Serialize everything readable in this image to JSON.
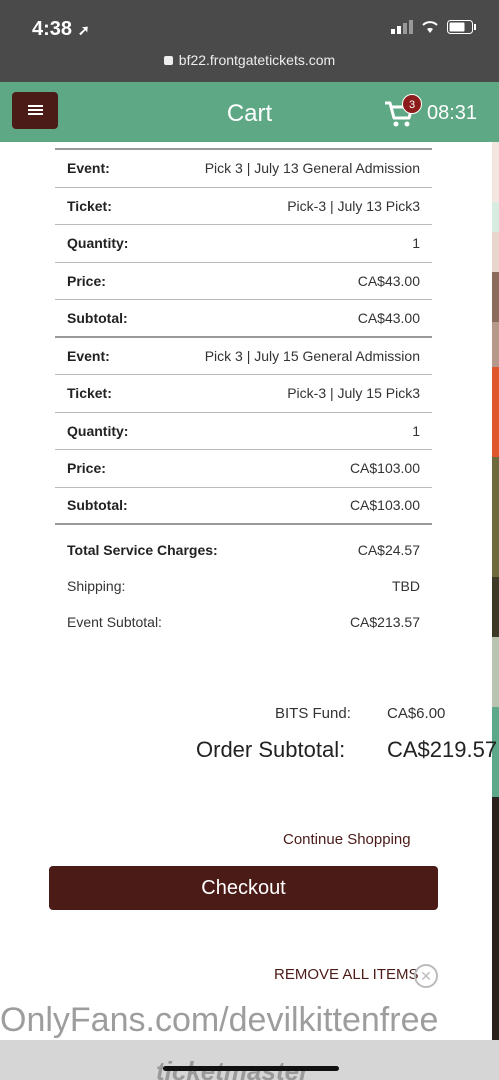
{
  "status_bar": {
    "time": "4:38",
    "url": "bf22.frontgatetickets.com"
  },
  "nav": {
    "title": "Cart",
    "cart_count": "3",
    "timer": "08:31"
  },
  "items": [
    {
      "event": "Pick 3 | July 13 General Admission",
      "ticket": "Pick-3 | July 13 Pick3",
      "quantity": "1",
      "price": "CA$43.00",
      "subtotal": "CA$43.00"
    },
    {
      "event": "Pick 3 | July 15 General Admission",
      "ticket": "Pick-3 | July 15 Pick3",
      "quantity": "1",
      "price": "CA$103.00",
      "subtotal": "CA$103.00"
    }
  ],
  "labels": {
    "event": "Event:",
    "ticket": "Ticket:",
    "quantity": "Quantity:",
    "price": "Price:",
    "subtotal": "Subtotal:"
  },
  "summary": {
    "service_label": "Total Service Charges:",
    "service_value": "CA$24.57",
    "shipping_label": "Shipping:",
    "shipping_value": "TBD",
    "event_subtotal_label": "Event Subtotal:",
    "event_subtotal_value": "CA$213.57"
  },
  "totals": {
    "bits_label": "BITS Fund:",
    "bits_value": "CA$6.00",
    "order_label": "Order Subtotal:",
    "order_value": "CA$219.57"
  },
  "actions": {
    "continue": "Continue Shopping",
    "checkout": "Checkout",
    "remove_all": "REMOVE ALL ITEMS"
  },
  "watermark": "OnlyFans.com/devilkittenfree",
  "footer_logo": "ticketmaster",
  "colors": {
    "nav": "#5ea885",
    "brand_dark": "#4b1b17",
    "badge": "#8c1b1b"
  }
}
